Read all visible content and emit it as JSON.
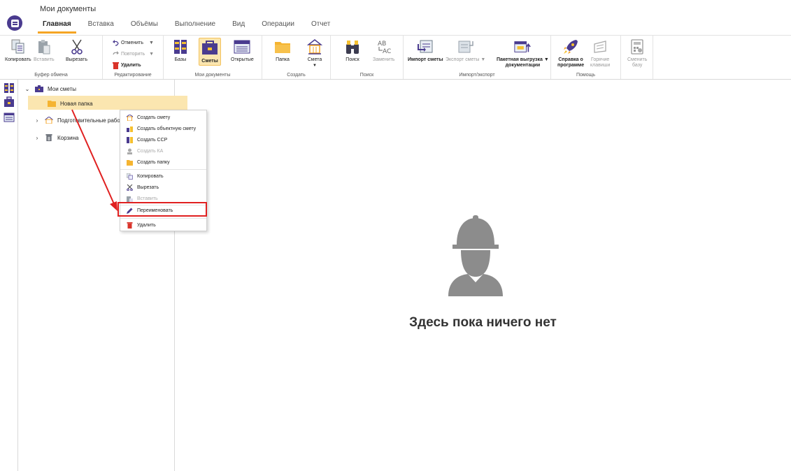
{
  "window": {
    "title": "Мои документы"
  },
  "tabs": [
    "Главная",
    "Вставка",
    "Объёмы",
    "Выполнение",
    "Вид",
    "Операции",
    "Отчет"
  ],
  "ribbon": {
    "clipboard": {
      "caption": "Буфер обмена",
      "copy": "Копировать",
      "paste": "Вставить",
      "cut": "Вырезать"
    },
    "editing": {
      "caption": "Редактирование",
      "undo": "Отменить",
      "redo": "Повторить",
      "delete": "Удалить"
    },
    "mydocs": {
      "caption": "Мои документы",
      "bases": "Базы",
      "estimates": "Сметы",
      "opened": "Открытые"
    },
    "create": {
      "caption": "Создать",
      "folder": "Папка",
      "estimate": "Смета"
    },
    "search": {
      "caption": "Поиск",
      "find": "Поиск",
      "replace": "Заменить"
    },
    "importexport": {
      "caption": "Импорт/экспорт",
      "import": "Импорт сметы",
      "export": "Экспорт сметы",
      "batch_line1": "Пакетная выгрузка",
      "batch_line2": "документации"
    },
    "help": {
      "caption": "Помощь",
      "about_line1": "Справка о",
      "about_line2": "программе",
      "hotkeys_line1": "Горячие",
      "hotkeys_line2": "клавиши"
    },
    "switchbase": {
      "line1": "Сменить",
      "line2": "базу"
    }
  },
  "tree": {
    "root": "Мои сметы",
    "new_folder": "Новая папка",
    "prep": "Подготовительные работы",
    "trash": "Корзина"
  },
  "context_menu": {
    "create_estimate": "Создать смету",
    "create_object_estimate": "Создать объектную смету",
    "create_ssr": "Создать ССР",
    "create_ka": "Создать КА",
    "create_folder": "Создать папку",
    "copy": "Копировать",
    "cut": "Вырезать",
    "paste": "Вставить",
    "rename": "Переименовать",
    "delete": "Удалить"
  },
  "empty_state": {
    "text": "Здесь пока ничего нет"
  },
  "colors": {
    "accent": "#f5a524",
    "brand": "#4a3b8f",
    "highlight": "#e02020",
    "selection": "#fbe6b0"
  }
}
